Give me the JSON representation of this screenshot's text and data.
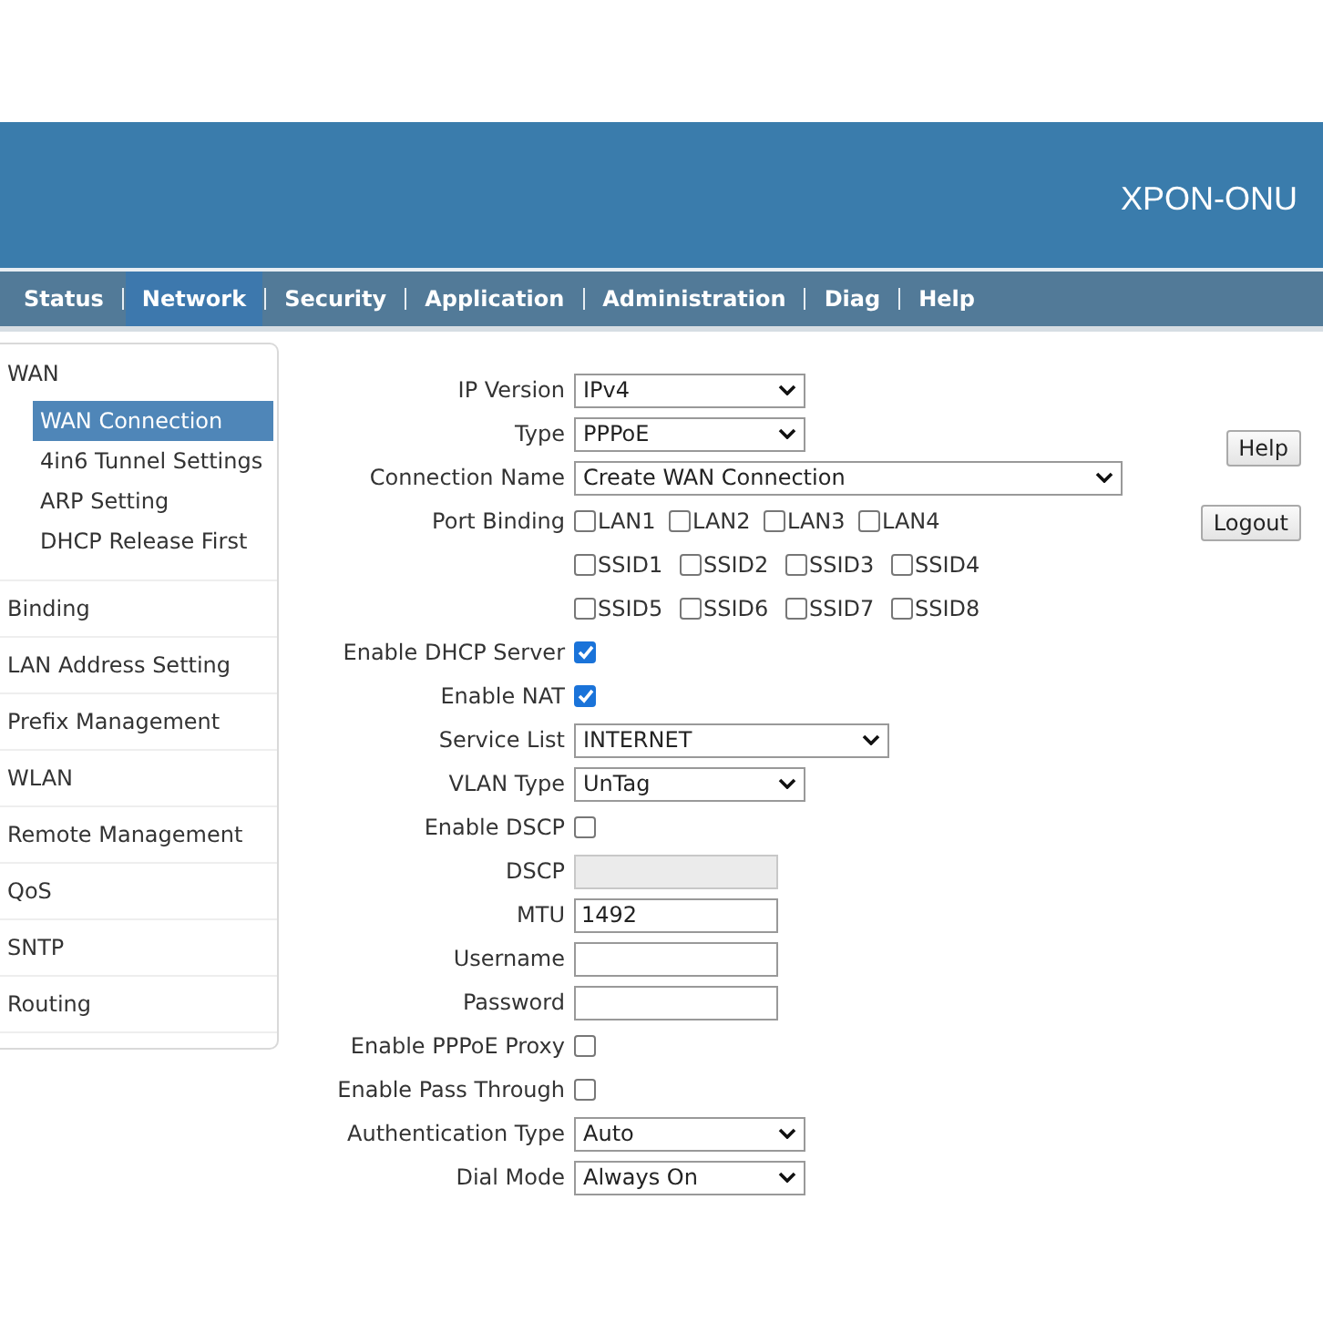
{
  "header": {
    "title": "XPON-ONU"
  },
  "menu": [
    {
      "label": "Status",
      "selected": false
    },
    {
      "label": "Network",
      "selected": true
    },
    {
      "label": "Security",
      "selected": false
    },
    {
      "label": "Application",
      "selected": false
    },
    {
      "label": "Administration",
      "selected": false
    },
    {
      "label": "Diag",
      "selected": false
    },
    {
      "label": "Help",
      "selected": false
    }
  ],
  "sidebar": [
    {
      "label": "WAN",
      "selected": false,
      "children": [
        {
          "label": "WAN Connection",
          "selected": true
        },
        {
          "label": "4in6 Tunnel Settings",
          "selected": false
        },
        {
          "label": "ARP Setting",
          "selected": false
        },
        {
          "label": "DHCP Release First",
          "selected": false
        }
      ]
    },
    {
      "label": "Binding",
      "selected": false
    },
    {
      "label": "LAN Address Setting",
      "selected": false
    },
    {
      "label": "Prefix Management",
      "selected": false
    },
    {
      "label": "WLAN",
      "selected": false
    },
    {
      "label": "Remote Management",
      "selected": false
    },
    {
      "label": "QoS",
      "selected": false
    },
    {
      "label": "SNTP",
      "selected": false
    },
    {
      "label": "Routing",
      "selected": false
    }
  ],
  "form": [
    {
      "kind": "select",
      "label": "IP Version",
      "value": "IPv4"
    },
    {
      "kind": "select",
      "label": "Type",
      "value": "PPPoE"
    },
    {
      "kind": "select",
      "label": "Connection Name",
      "value": "Create WAN Connection"
    },
    {
      "kind": "checkgroup",
      "label": "Port Binding",
      "lines": [
        [
          {
            "label": "LAN1",
            "checked": false
          },
          {
            "label": "LAN2",
            "checked": false
          },
          {
            "label": "LAN3",
            "checked": false
          },
          {
            "label": "LAN4",
            "checked": false
          }
        ],
        [
          {
            "label": "SSID1",
            "checked": false
          },
          {
            "label": "SSID2",
            "checked": false
          },
          {
            "label": "SSID3",
            "checked": false
          },
          {
            "label": "SSID4",
            "checked": false
          }
        ],
        [
          {
            "label": "SSID5",
            "checked": false
          },
          {
            "label": "SSID6",
            "checked": false
          },
          {
            "label": "SSID7",
            "checked": false
          },
          {
            "label": "SSID8",
            "checked": false
          }
        ]
      ]
    },
    {
      "kind": "checkbox",
      "label": "Enable DHCP Server",
      "checked": true
    },
    {
      "kind": "checkbox",
      "label": "Enable NAT",
      "checked": true
    },
    {
      "kind": "select",
      "label": "Service List",
      "value": "INTERNET"
    },
    {
      "kind": "select",
      "label": "VLAN Type",
      "value": "UnTag"
    },
    {
      "kind": "checkbox",
      "label": "Enable DSCP",
      "checked": false
    },
    {
      "kind": "text",
      "label": "DSCP",
      "disabled": true
    },
    {
      "kind": "text",
      "label": "MTU",
      "value": "1492",
      "disabled": false
    },
    {
      "kind": "text",
      "label": "Username",
      "disabled": false
    },
    {
      "kind": "text",
      "label": "Password",
      "disabled": false
    },
    {
      "kind": "checkbox",
      "label": "Enable PPPoE Proxy",
      "checked": false
    },
    {
      "kind": "checkbox",
      "label": "Enable Pass Through",
      "checked": false
    },
    {
      "kind": "select",
      "label": "Authentication Type",
      "value": "Auto"
    },
    {
      "kind": "select",
      "label": "Dial Mode",
      "value": "Always On"
    }
  ],
  "buttons": [
    "Help",
    "Logout"
  ]
}
